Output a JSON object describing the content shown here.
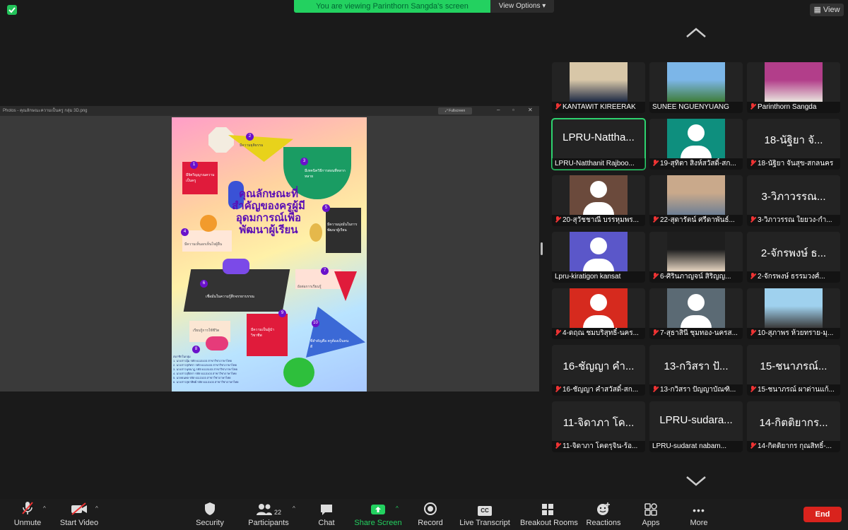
{
  "banner": {
    "text": "You are viewing Parinthorn Sangda's screen",
    "options_label": "View Options",
    "view_label": "View"
  },
  "shared_window": {
    "title": "Photos - คุณลักษณะความเป็นครู กลุ่ม 3D.png",
    "fullscreen_label": "Fullscreen",
    "poster": {
      "title": "คุณลักษณะที่สำคัญของครูผู้มีอุดมการณ์เพื่อพัฒนาผู้เรียน",
      "numbers": [
        "1",
        "2",
        "3",
        "4",
        "5",
        "6",
        "7",
        "8",
        "9",
        "10"
      ],
      "notes": [
        "มีจิตวิญญาณความเป็นครู",
        "มีความยุติธรรม",
        "มีเทคนิควิธีการสอนที่หลากหลาย",
        "มีความเห็นอกเห็นใจผู้อื่น",
        "มีความมุ่งมั่นในการพัฒนาผู้เรียน",
        "เชื่อมั่นในความรู้สึกจรรยาบรรณ",
        "ยังต่อการเรียนรู้",
        "เรียนรู้การใช้ชีวิต",
        "มีความเป็นผู้นำวิชาชีพ",
        "ที่สำคัญคือ ครูต้องเป็นคนดี"
      ],
      "credits_heading": "สมาชิกในกลุ่ม",
      "credits": [
        "1. นางสาวอุ้ม รหัส 6113103 สาขาวิชาภาษาไทย",
        "2. นางสาวสุภัทรา รหัส 6113103 สาขาวิชาภาษาไทย",
        "3. นางสาวนุชนาฏ รหัส 6113103 สาขาวิชาภาษาไทย",
        "4. นางสาวสุจิตรา รหัส 6113103 สาขาวิชาภาษาไทย",
        "5. นายธนพล รหัส 6113103 สาขาวิชาภาษาไทย",
        "6. นางสาวสุธาทิพย์ รหัส 6113103 สาขาวิชาภาษาไทย"
      ]
    }
  },
  "gallery": [
    {
      "big": "",
      "name": "KANTAWIT KIREERAK",
      "kind": "photo",
      "colors": [
        "#d8c7a8",
        "#1e2a44"
      ],
      "muted": true
    },
    {
      "big": "",
      "name": "SUNEE NGUENYUANG",
      "kind": "photo",
      "colors": [
        "#7cb6e8",
        "#3f7d3a"
      ],
      "muted": false
    },
    {
      "big": "",
      "name": "Parinthorn Sangda",
      "kind": "photo",
      "colors": [
        "#b23e8a",
        "#e9e4de"
      ],
      "muted": true
    },
    {
      "big": "LPRU-Nattha...",
      "name": "LPRU-Natthanit Rajboo...",
      "kind": "text",
      "muted": false,
      "active": true
    },
    {
      "big": "",
      "name": "19-สุทิตา สิงห์สวัสดิ์-สก...",
      "kind": "avatar",
      "colors": [
        "#0e8f7e"
      ],
      "muted": true
    },
    {
      "big": "18-นัฐิยา จั...",
      "name": "18-นัฐิยา จันสุข-สกลนคร",
      "kind": "text",
      "muted": true
    },
    {
      "big": "",
      "name": "20-สุวัชชาณี บรรหุมพร...",
      "kind": "avatar",
      "colors": [
        "#6b4a3c"
      ],
      "muted": true
    },
    {
      "big": "",
      "name": "22-สุดารัตน์ ศรีดาพันธ์...",
      "kind": "photo",
      "colors": [
        "#c9a98b",
        "#6d7f94"
      ],
      "muted": true
    },
    {
      "big": "3-วิภาวรรณ...",
      "name": "3-วิภาวรรณ ใยยวง-กำ...",
      "kind": "text",
      "muted": true
    },
    {
      "big": "",
      "name": "Lpru-kiratigon kansat",
      "kind": "avatar",
      "colors": [
        "#5b57c9"
      ],
      "muted": false
    },
    {
      "big": "",
      "name": "6-ศิรินภาญจน์ สิริญญ...",
      "kind": "photo",
      "colors": [
        "#1e1e1e",
        "#e7d6c2"
      ],
      "muted": true
    },
    {
      "big": "2-จักรพงษ์ ธ...",
      "name": "2-จักรพงษ์ ธรรมวงศ์...",
      "kind": "text",
      "muted": true
    },
    {
      "big": "",
      "name": "4-ดฤณ ชมบริสุทธิ์-นคร...",
      "kind": "avatar",
      "colors": [
        "#d62a1e"
      ],
      "muted": true
    },
    {
      "big": "",
      "name": "7-สุธาสินี ชุมทอง-นครส...",
      "kind": "avatar",
      "colors": [
        "#5b6a74"
      ],
      "muted": true
    },
    {
      "big": "",
      "name": "10-สุภาพร ห้วยทราย-มุ...",
      "kind": "photo",
      "colors": [
        "#9fd1ee",
        "#3a3a3a"
      ],
      "muted": true
    },
    {
      "big": "16-ชัญญา คำ...",
      "name": "16-ชัญญา คำสวัสดิ์-สก...",
      "kind": "text",
      "muted": true
    },
    {
      "big": "13-กวิสรา ปั...",
      "name": "13-กวิสรา ปัญญาบัณฑิ...",
      "kind": "text",
      "muted": true
    },
    {
      "big": "15-ชนาภรณ์...",
      "name": "15-ชนาภรณ์ ผาด่านแก้...",
      "kind": "text",
      "muted": true
    },
    {
      "big": "11-จิดาภา โค...",
      "name": "11-จิดาภา โคตรุจิน-ร้อ...",
      "kind": "text",
      "muted": true
    },
    {
      "big": "LPRU-sudara...",
      "name": "LPRU-sudarat nabam...",
      "kind": "text",
      "muted": false
    },
    {
      "big": "14-กิตติยากร...",
      "name": "14-กิตติยากร กุณสิทธิ์-...",
      "kind": "text",
      "muted": true
    }
  ],
  "toolbar": {
    "unmute": "Unmute",
    "start_video": "Start Video",
    "security": "Security",
    "participants": "Participants",
    "participants_count": "22",
    "chat": "Chat",
    "share_screen": "Share Screen",
    "record": "Record",
    "live_transcript": "Live Transcript",
    "breakout_rooms": "Breakout Rooms",
    "reactions": "Reactions",
    "apps": "Apps",
    "more": "More",
    "end": "End",
    "cc_glyph": "CC",
    "more_glyph": "•••"
  },
  "colors": {
    "share_green": "#23d160",
    "end_red": "#d9231d",
    "active_border": "#2dd36f"
  }
}
